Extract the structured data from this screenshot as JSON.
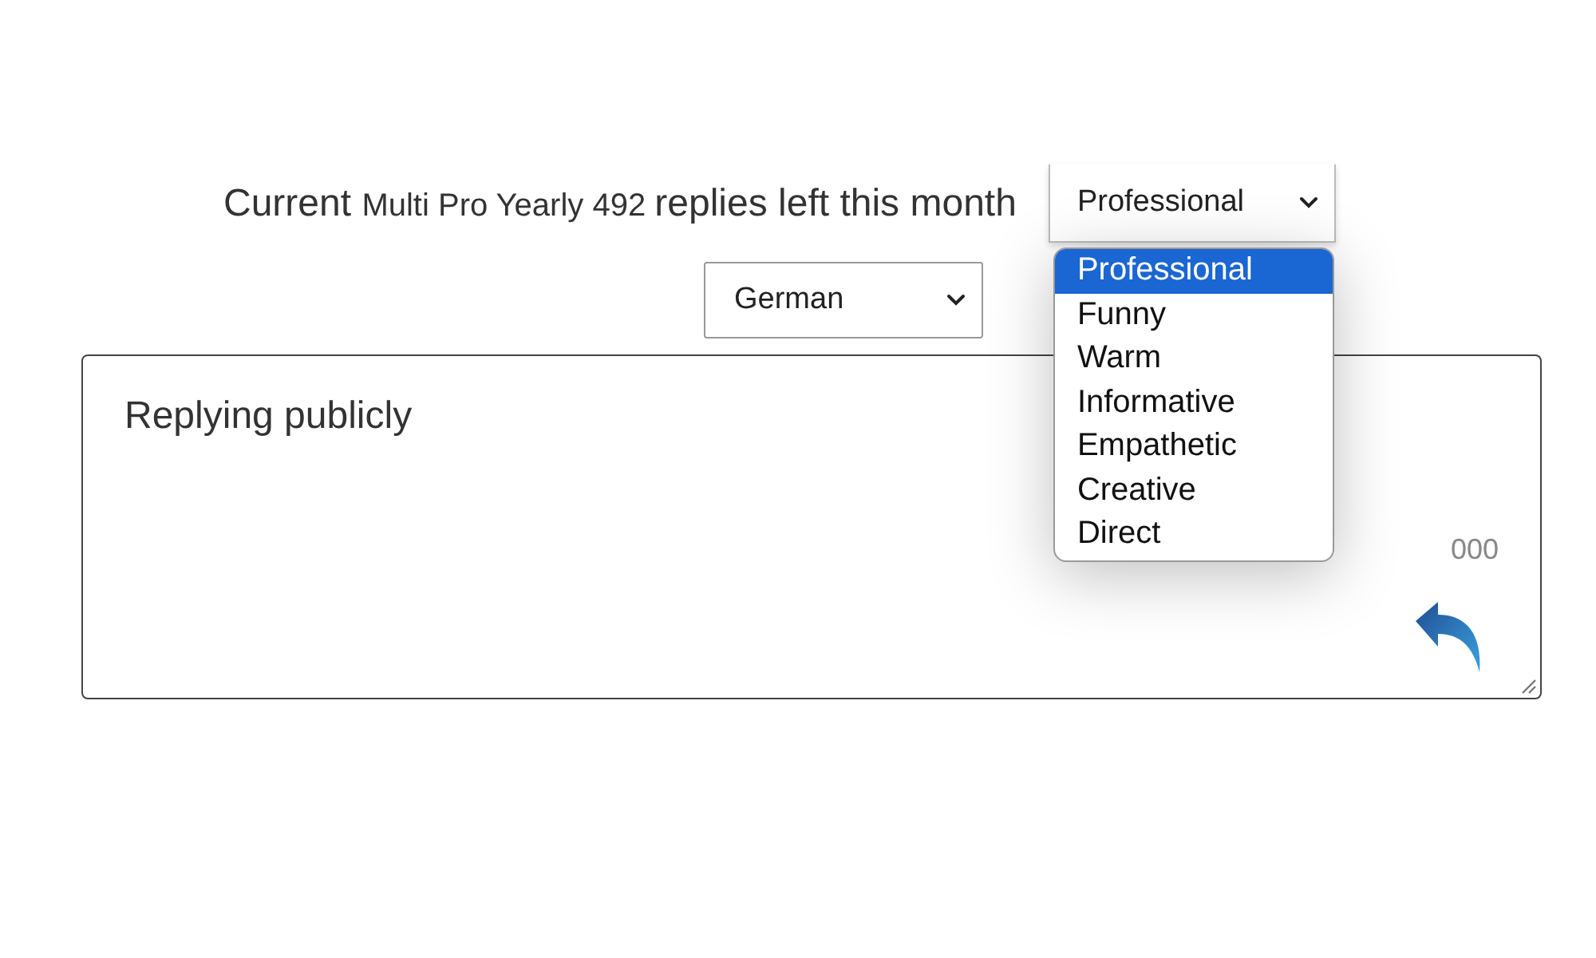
{
  "quota_line": {
    "prefix": "Current",
    "plan": "Multi Pro Yearly 492",
    "suffix": "replies left this month"
  },
  "tone_select": {
    "value": "Professional",
    "expanded": true,
    "options": [
      {
        "label": "Professional",
        "selected": true
      },
      {
        "label": "Funny",
        "selected": false
      },
      {
        "label": "Warm",
        "selected": false
      },
      {
        "label": "Informative",
        "selected": false
      },
      {
        "label": "Empathetic",
        "selected": false
      },
      {
        "label": "Creative",
        "selected": false
      },
      {
        "label": "Direct",
        "selected": false
      }
    ]
  },
  "language_select": {
    "value": "German"
  },
  "reply_box": {
    "placeholder": "Replying publicly",
    "counter": "000"
  }
}
